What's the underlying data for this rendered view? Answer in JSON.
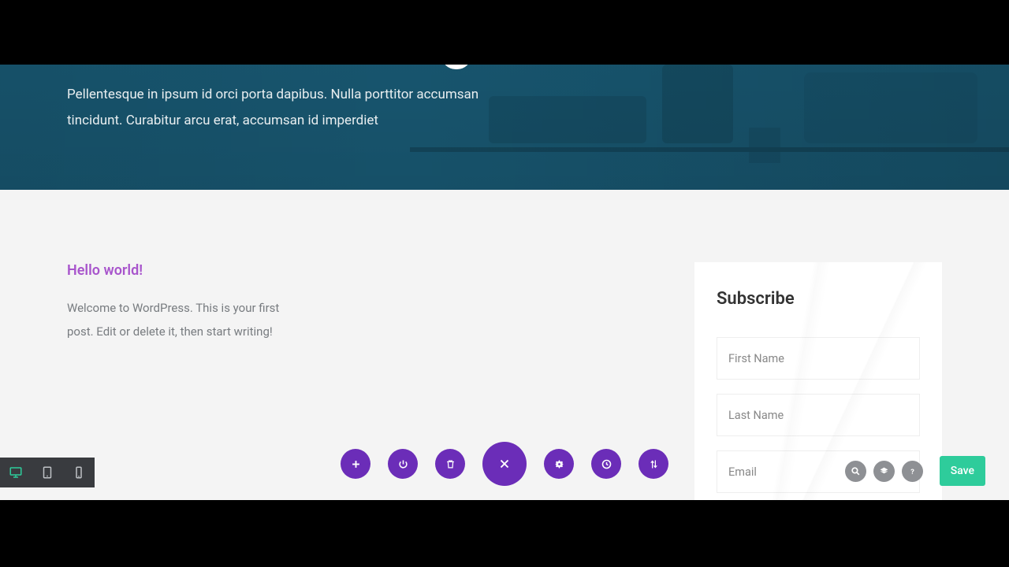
{
  "hero": {
    "paragraph": "Pellentesque in ipsum id orci porta dapibus. Nulla porttitor accumsan tincidunt. Curabitur arcu erat, accumsan id imperdiet"
  },
  "post": {
    "title": "Hello world!",
    "body": "Welcome to WordPress. This is your first post. Edit or delete it, then start writing!"
  },
  "subscribe": {
    "title": "Subscribe",
    "fields": {
      "first_name": "First Name",
      "last_name": "Last Name",
      "email": "Email"
    }
  },
  "toolbar": {
    "save_label": "Save"
  },
  "colors": {
    "purple": "#6b2db8",
    "teal": "#2ecc9b",
    "hero": "#1a5e7a",
    "link": "#a855cc"
  }
}
